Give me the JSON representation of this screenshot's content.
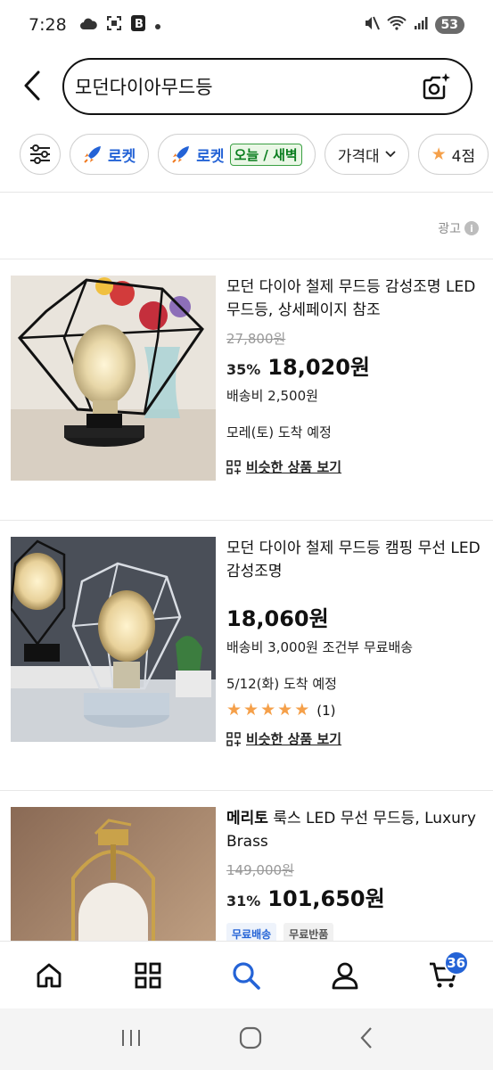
{
  "status_bar": {
    "time": "7:28",
    "battery": "53"
  },
  "search": {
    "query": "모던다이아무드등"
  },
  "chips": {
    "rocket": "로켓",
    "rocket_fresh": "로켓",
    "today": "오늘 / 새벽",
    "price": "가격대",
    "rating": "4점"
  },
  "ad_label": "광고",
  "ad_info": "i",
  "products": [
    {
      "title": "모던 다이아 철제 무드등 감성조명 LED 무드등, 상세페이지 참조",
      "original_price": "27,800원",
      "discount": "35%",
      "price": "18,020원",
      "shipping": "배송비 2,500원",
      "arrival": "모레(토) 도착 예정",
      "similar": "비슷한 상품 보기"
    },
    {
      "title": "모던 다이아 철제 무드등 캠핑 무선 LED 감성조명",
      "price": "18,060원",
      "shipping": "배송비 3,000원 조건부 무료배송",
      "arrival": "5/12(화) 도착 예정",
      "rating": 5,
      "review_count": "(1)",
      "similar": "비슷한 상품 보기"
    },
    {
      "brand": "메리토",
      "title": "룩스 LED 무선 무드등, Luxury Brass",
      "original_price": "149,000원",
      "discount": "31%",
      "price": "101,650원",
      "badges": [
        "무료배송",
        "무료반품"
      ]
    }
  ],
  "bottom_nav": {
    "cart_count": "36"
  },
  "colors": {
    "accent": "#2463d6",
    "star": "#f5a04a",
    "fresh_green": "#0a7d1e"
  }
}
